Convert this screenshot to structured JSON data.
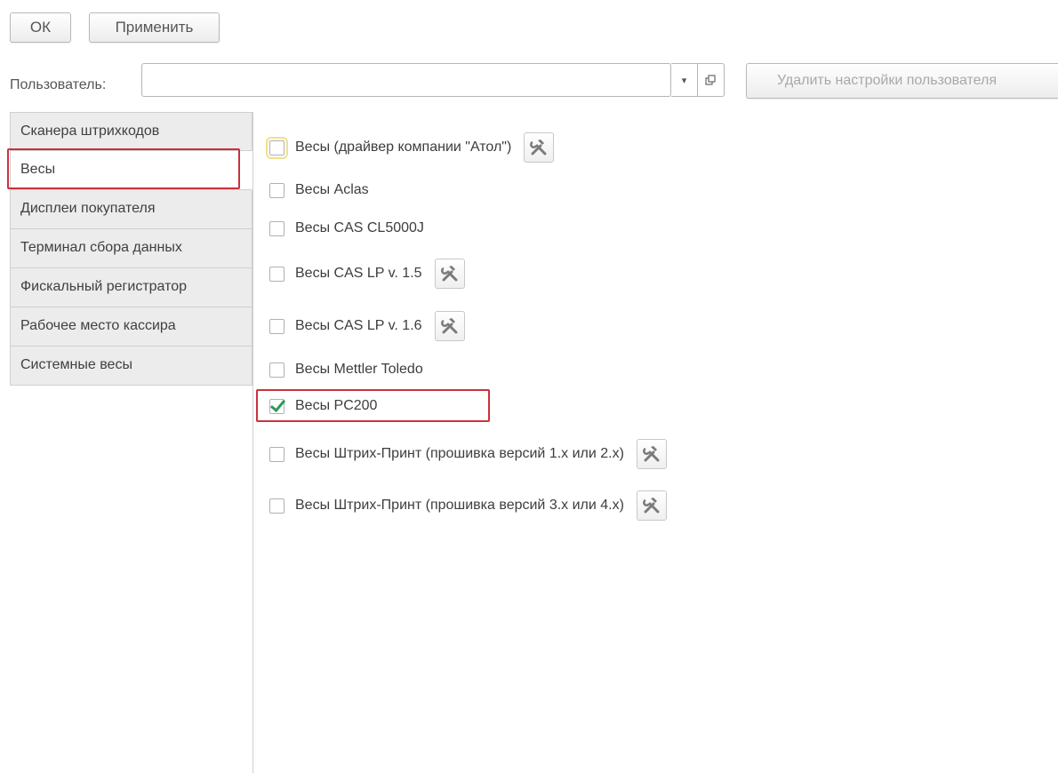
{
  "toolbar": {
    "ok_label": "ОК",
    "apply_label": "Применить"
  },
  "user": {
    "label": "Пользователь:",
    "value": "",
    "delete_label": "Удалить настройки пользователя"
  },
  "tabs": [
    {
      "label": "Сканера штрихкодов",
      "active": false
    },
    {
      "label": "Весы",
      "active": true
    },
    {
      "label": "Дисплеи покупателя",
      "active": false
    },
    {
      "label": "Терминал сбора данных",
      "active": false
    },
    {
      "label": "Фискальный регистратор",
      "active": false
    },
    {
      "label": "Рабочее место кассира",
      "active": false
    },
    {
      "label": "Системные весы",
      "active": false
    }
  ],
  "options": [
    {
      "label": "Весы (драйвер компании \"Атол\")",
      "checked": false,
      "has_settings": true,
      "focused": true
    },
    {
      "label": "Весы Aclas",
      "checked": false,
      "has_settings": false
    },
    {
      "label": "Весы CAS CL5000J",
      "checked": false,
      "has_settings": false
    },
    {
      "label": "Весы CAS LP v. 1.5",
      "checked": false,
      "has_settings": true
    },
    {
      "label": "Весы CAS LP v. 1.6",
      "checked": false,
      "has_settings": true
    },
    {
      "label": "Весы Mettler Toledo",
      "checked": false,
      "has_settings": false
    },
    {
      "label": "Весы PC200",
      "checked": true,
      "has_settings": false
    },
    {
      "label": "Весы Штрих-Принт (прошивка версий 1.x или 2.x)",
      "checked": false,
      "has_settings": true
    },
    {
      "label": "Весы Штрих-Принт (прошивка версий 3.x или 4.x)",
      "checked": false,
      "has_settings": true
    }
  ],
  "icons": {
    "settings": "tools-icon",
    "dropdown": "chevron-down-icon",
    "open": "open-window-icon"
  },
  "colors": {
    "highlight": "#c9323d",
    "check": "#2a9a55"
  }
}
